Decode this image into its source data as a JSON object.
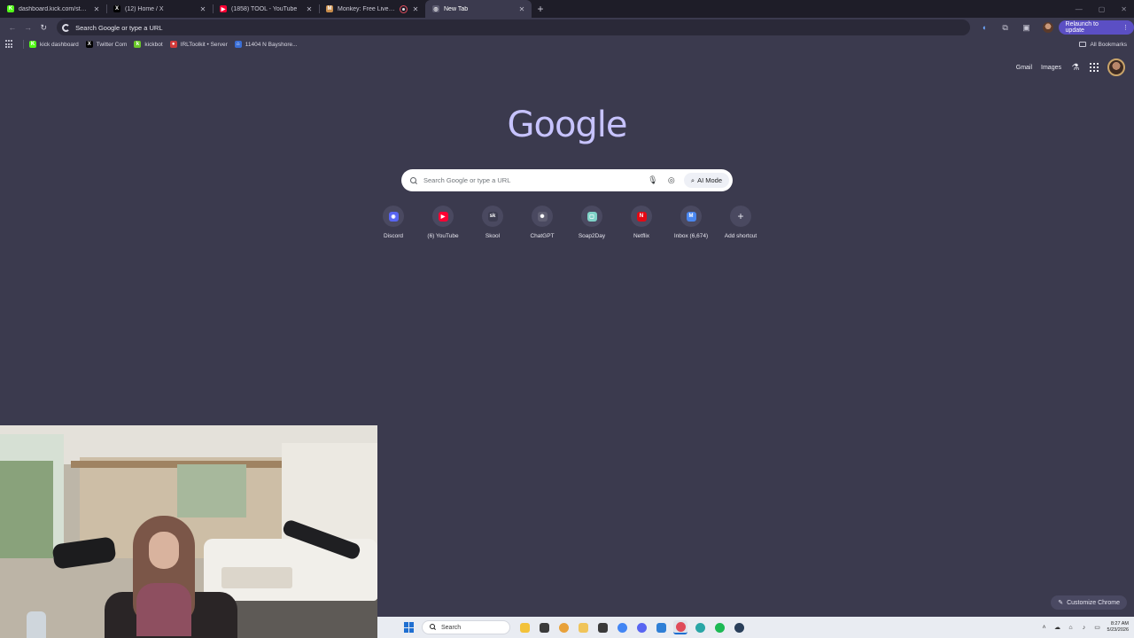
{
  "tabs": [
    {
      "title": "dashboard.kick.com/stream",
      "favicon": "K",
      "favicon_color": "#53fc18",
      "active": false,
      "audio": false
    },
    {
      "title": "(12) Home / X",
      "favicon": "X",
      "favicon_color": "#000000",
      "active": false,
      "audio": false
    },
    {
      "title": "(1858) TOOL - YouTube",
      "favicon": "▶",
      "favicon_color": "#ff0033",
      "active": false,
      "audio": false
    },
    {
      "title": "Monkey: Free Live Video C",
      "favicon": "M",
      "favicon_color": "#c98d4b",
      "active": false,
      "audio": true
    },
    {
      "title": "New Tab",
      "favicon": "◎",
      "favicon_color": "#5c5b70",
      "active": true,
      "audio": false
    }
  ],
  "tab_close_glyph": "✕",
  "new_tab_glyph": "+",
  "window_controls": {
    "minimize": "—",
    "maximize": "▢",
    "close": "✕"
  },
  "toolbar": {
    "omnibox_text": "Search Google or type a URL",
    "relaunch_label": "Relaunch to update",
    "relaunch_menu_glyph": "⋮",
    "icons": [
      "voice-search-icon",
      "extensions-icon",
      "side-panel-icon",
      "profile-icon"
    ]
  },
  "bookmarks": [
    {
      "label": "kick dashboard",
      "icon": "K",
      "color": "#53fc18"
    },
    {
      "label": "Twitter Com",
      "icon": "X",
      "color": "#000000"
    },
    {
      "label": "kickbot",
      "icon": "k",
      "color": "#6bc82a"
    },
    {
      "label": "IRLToolkit • Server",
      "icon": "●",
      "color": "#d23a3a"
    },
    {
      "label": "11404 N Bayshore...",
      "icon": "⌂",
      "color": "#3a6ed6"
    }
  ],
  "all_bookmarks_label": "All Bookmarks",
  "ntp": {
    "gmail_label": "Gmail",
    "images_label": "Images",
    "logo_text": "Google",
    "search_placeholder": "Search Google or type a URL",
    "ai_mode_label": "AI Mode",
    "customize_label": "Customize Chrome"
  },
  "shortcuts": [
    {
      "label": "Discord",
      "icon": "◉",
      "color": "#5865f2"
    },
    {
      "label": "(6) YouTube",
      "icon": "▶",
      "color": "#ff0033"
    },
    {
      "label": "Skool",
      "icon": "sk",
      "color": "#3c3c50"
    },
    {
      "label": "ChatGPT",
      "icon": "✺",
      "color": "#5f5e72"
    },
    {
      "label": "Soap2Day",
      "icon": "▢",
      "color": "#7fd3c8"
    },
    {
      "label": "Netflix",
      "icon": "N",
      "color": "#e50914"
    },
    {
      "label": "Inbox (6,674)",
      "icon": "M",
      "color": "#4a87f0"
    },
    {
      "label": "Add shortcut",
      "icon": "+",
      "color": "transparent"
    }
  ],
  "taskbar": {
    "search_label": "Search",
    "apps": [
      {
        "name": "file-explorer",
        "color": "#f3c23a"
      },
      {
        "name": "task-view",
        "color": "#3a3a3a"
      },
      {
        "name": "chrome-canary",
        "color": "#e8a13a"
      },
      {
        "name": "files",
        "color": "#f0c45a"
      },
      {
        "name": "obs",
        "color": "#3a3a3a"
      },
      {
        "name": "chrome",
        "color": "#4285f4"
      },
      {
        "name": "discord",
        "color": "#5865f2"
      },
      {
        "name": "calculator",
        "color": "#2f7fd6"
      },
      {
        "name": "chrome-active",
        "color": "#e04b5a"
      },
      {
        "name": "edge",
        "color": "#2aa6a6"
      },
      {
        "name": "spotify",
        "color": "#1db954"
      },
      {
        "name": "steam",
        "color": "#2a3f5a"
      }
    ],
    "tray_glyphs": [
      "˄",
      "☁",
      "⌂",
      "♪",
      "▭"
    ],
    "time": "8:27 AM",
    "date": "5/23/2026"
  }
}
